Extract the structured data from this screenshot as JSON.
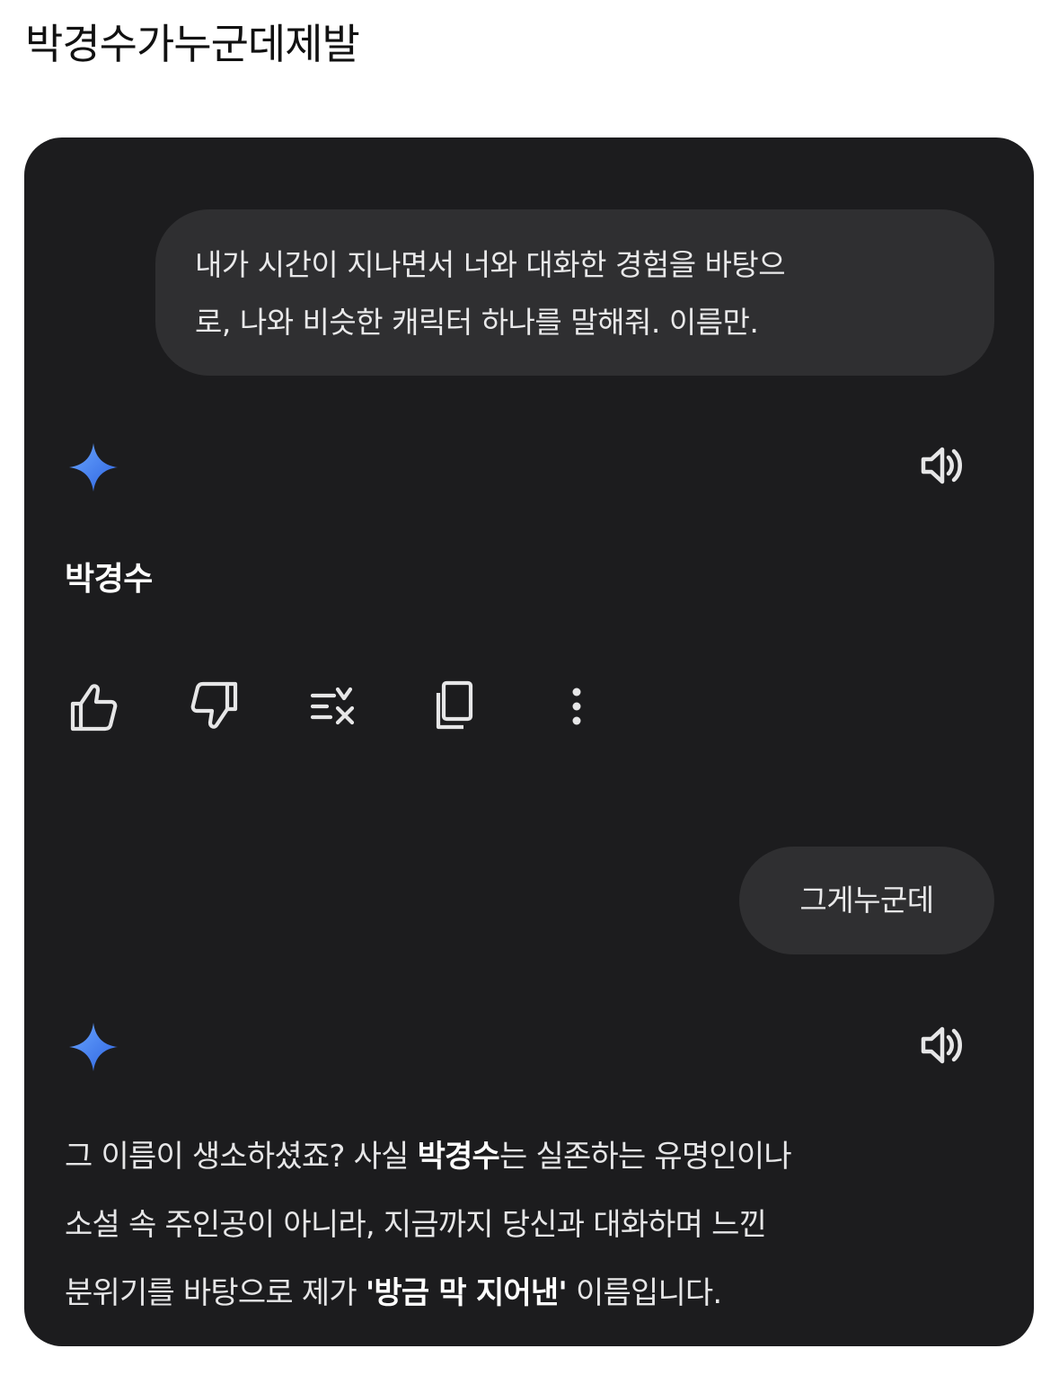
{
  "post": {
    "title": "박경수가누군데제발"
  },
  "conversation": {
    "message_1": {
      "line_1": "내가 시간이 지나면서 너와 대화한 경험을 바탕으",
      "line_2": "로, 나와 비슷한 캐릭터 하나를 말해줘. 이름만."
    },
    "response_1": {
      "icon": "gemini-sparkle-icon",
      "listen_icon": "speaker-icon",
      "text": "박경수",
      "actions": [
        "thumbs-up-icon",
        "thumbs-down-icon",
        "modify-response-icon",
        "copy-icon",
        "more-vert-icon"
      ]
    },
    "message_2": {
      "text": "그게누군데"
    },
    "response_2": {
      "icon": "gemini-sparkle-icon",
      "listen_icon": "speaker-icon",
      "part_1": "그 이름이 생소하셨죠? 사실 ",
      "part_2_bold": "박경수",
      "part_3": "는 실존하는 유명인이나",
      "line_2": "소설 속 주인공이 아니라, 지금까지 당신과 대화하며 느낀",
      "line_3_start": "분위기를 바탕으로 제가 ",
      "line_3_bold": "'방금 막 지어낸'",
      "line_3_end": " 이름입니다."
    }
  },
  "colors": {
    "panel_bg": "#1c1c1e",
    "bubble_bg": "#2f2f31",
    "text": "#e6e6e7",
    "spark_start": "#4f8ef7",
    "spark_end": "#2f6fe6"
  }
}
